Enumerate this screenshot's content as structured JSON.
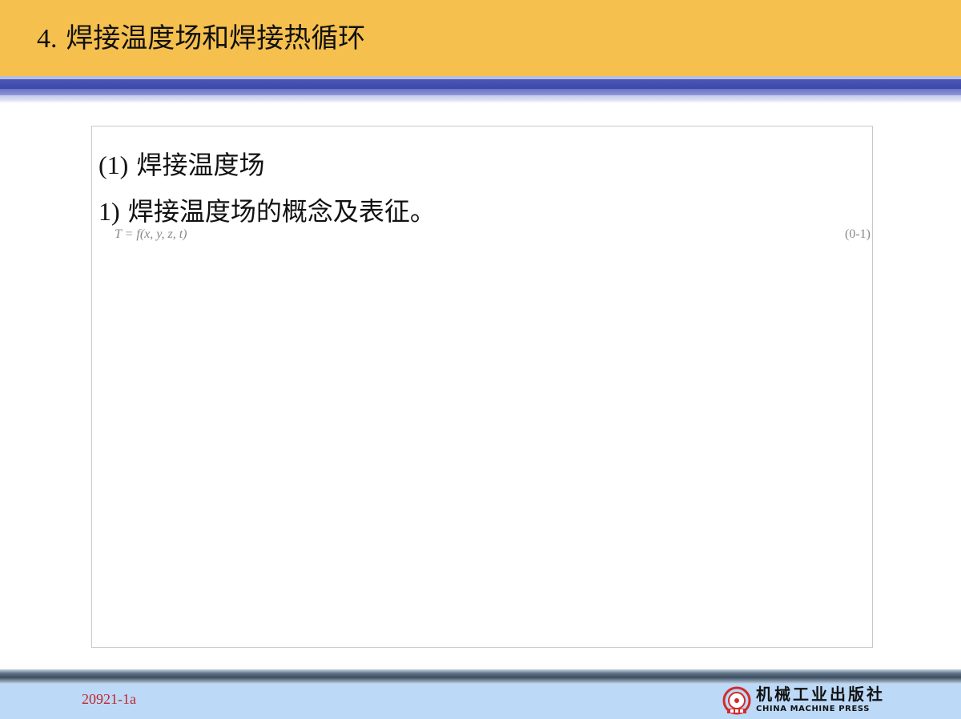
{
  "header": {
    "number": "4.",
    "title": "焊接温度场和焊接热循环"
  },
  "content": {
    "heading1_number": "(1)",
    "heading1_text": "焊接温度场",
    "heading2_number": "1)",
    "heading2_text": "焊接温度场的概念及表征。",
    "formula": "T = f(x, y, z, t)",
    "formula_number": "(0-1)"
  },
  "footer": {
    "code": "20921-1a",
    "publisher_cn": "机械工业出版社",
    "publisher_en": "CHINA MACHINE PRESS"
  },
  "colors": {
    "header_bg": "#f5c04e",
    "footer_bg": "#bcd9f7",
    "footer_code": "#c0272d",
    "logo_red": "#d42a2a"
  }
}
